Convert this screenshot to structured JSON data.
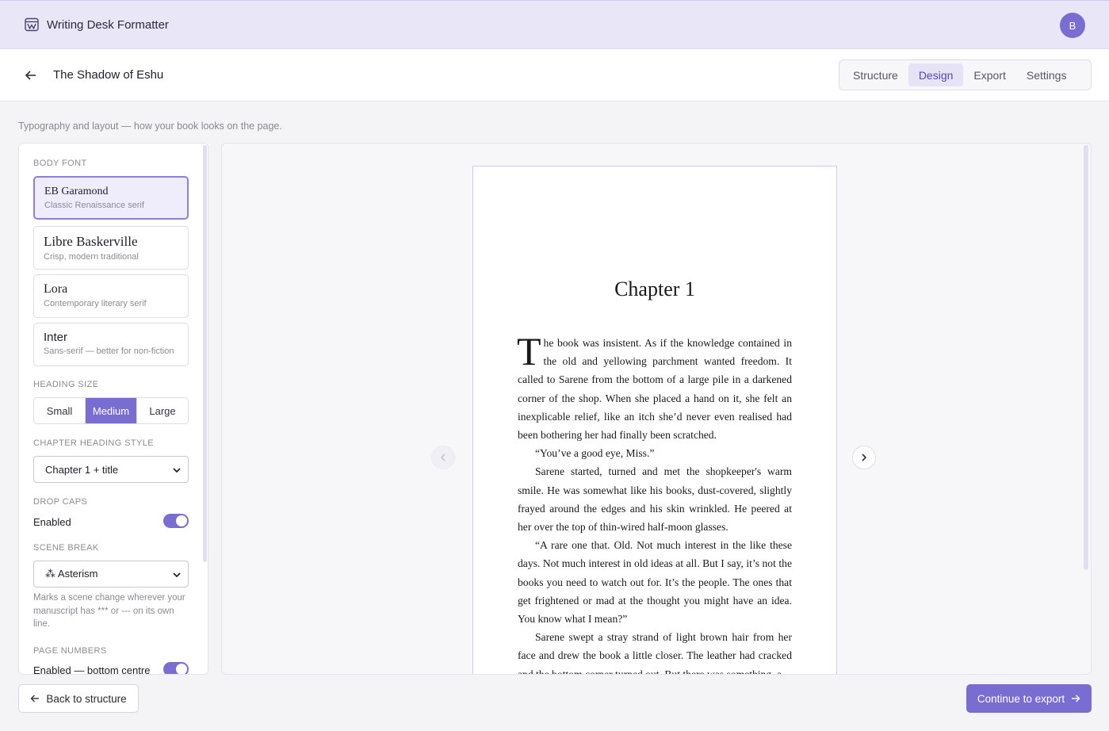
{
  "app": {
    "title": "Writing Desk Formatter",
    "avatar_initial": "B"
  },
  "header": {
    "book_title": "The Shadow of Eshu",
    "tabs": [
      {
        "label": "Structure",
        "active": false
      },
      {
        "label": "Design",
        "active": true
      },
      {
        "label": "Export",
        "active": false
      },
      {
        "label": "Settings",
        "active": false
      }
    ]
  },
  "subtitle": "Typography and layout — how your book looks on the page.",
  "settings": {
    "body_font": {
      "label": "Body font",
      "options": [
        {
          "name": "EB Garamond",
          "desc": "Classic Renaissance serif",
          "selected": true
        },
        {
          "name": "Libre Baskerville",
          "desc": "Crisp, modern traditional",
          "selected": false
        },
        {
          "name": "Lora",
          "desc": "Contemporary literary serif",
          "selected": false
        },
        {
          "name": "Inter",
          "desc": "Sans-serif — better for non-fiction",
          "selected": false
        }
      ]
    },
    "heading_size": {
      "label": "Heading size",
      "options": [
        "Small",
        "Medium",
        "Large"
      ],
      "selected": "Medium"
    },
    "chapter_heading_style": {
      "label": "Chapter heading style",
      "value": "Chapter 1 + title"
    },
    "drop_caps": {
      "label": "Drop caps",
      "value": "Enabled",
      "on": true
    },
    "scene_break": {
      "label": "Scene break",
      "value": "⁂ Asterism",
      "help": "Marks a scene change wherever your manuscript has *** or --- on its own line."
    },
    "page_numbers": {
      "label": "Page numbers",
      "value": "Enabled — bottom centre",
      "on": true
    }
  },
  "preview": {
    "chapter_title": "Chapter 1",
    "drop_cap": "T",
    "first_paragraph": "he book was insistent. As if the knowledge contained in the old and yellowing parchment wanted freedom. It called to Sarene from the bottom of a large pile in a darkened corner of the shop. When she placed a hand on it, she felt an inexplicable relief, like an itch she’d never even realised had been bothering her had finally been scratched.",
    "paragraphs": [
      "“You’ve a good eye, Miss.”",
      "Sarene started, turned and met the shopkeeper's warm smile. He was somewhat like his books, dust-covered, slightly frayed around the edges and his skin wrinkled. He peered at her over the top of thin-wired half-moon glasses.",
      "“A rare one that. Old. Not much interest in the like these days. Not much interest in old ideas at all. But I say, it’s not the books you need to watch out for. It’s the people. The ones that get frightened or mad at the thought you might have an idea. You know what I mean?”",
      "Sarene swept a stray strand of light brown hair from her face and drew the book a little closer. The leather had cracked and the bottom corner turned out. But there was something, a"
    ]
  },
  "footer": {
    "back_label": "Back to structure",
    "next_label": "Continue to export"
  },
  "colors": {
    "accent": "#7a6dd1",
    "appbar_bg": "#e8e6f7",
    "active_tab_text": "#5846b8"
  }
}
